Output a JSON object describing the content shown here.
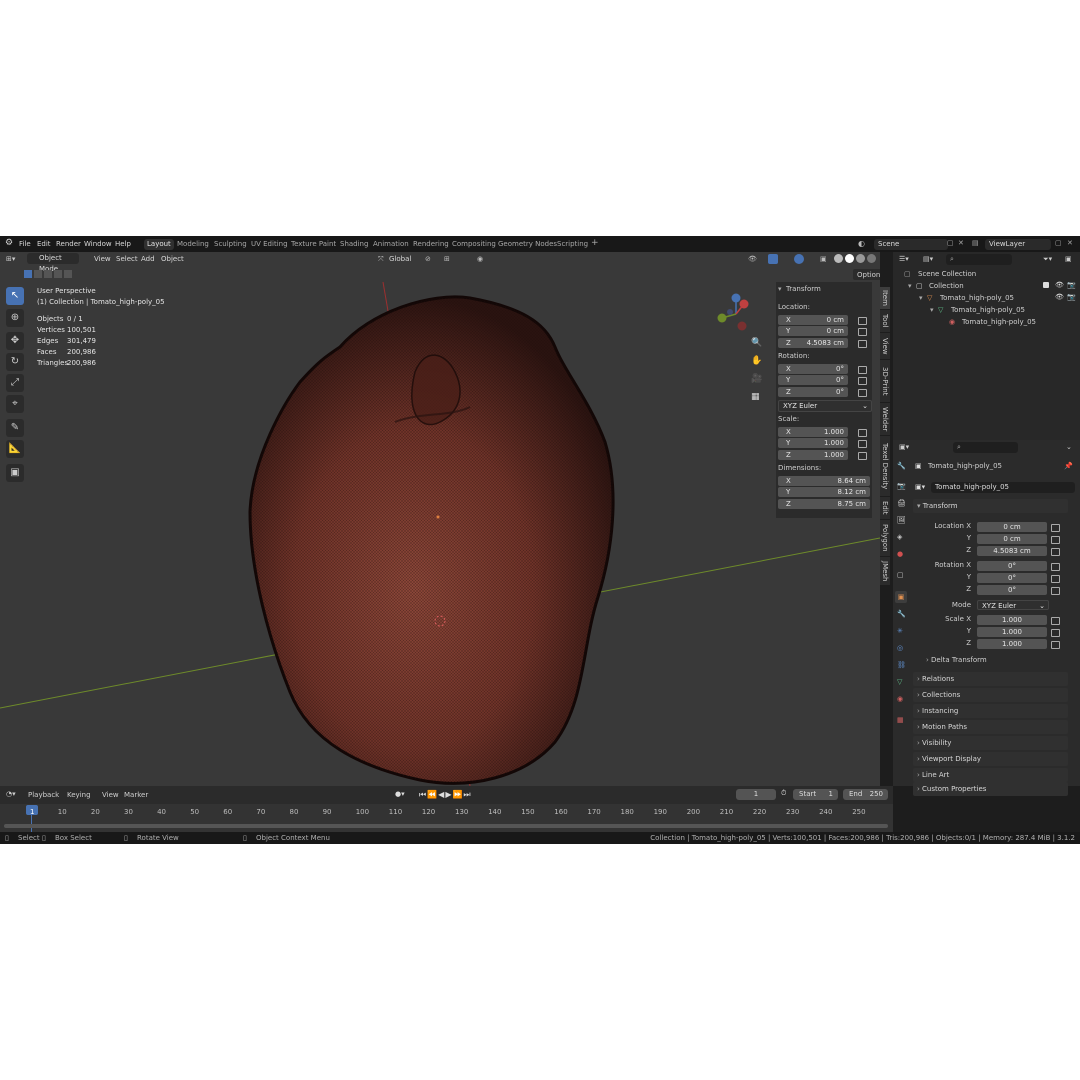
{
  "topbar": {
    "menus": [
      "File",
      "Edit",
      "Render",
      "Window",
      "Help"
    ],
    "workspaces": [
      "Layout",
      "Modeling",
      "Sculpting",
      "UV Editing",
      "Texture Paint",
      "Shading",
      "Animation",
      "Rendering",
      "Compositing",
      "Geometry Nodes",
      "Scripting"
    ],
    "active_workspace": "Layout",
    "add_tab": "+",
    "scene": "Scene",
    "view_layer": "ViewLayer"
  },
  "viewport_header": {
    "mode": "Object Mode",
    "menus": [
      "View",
      "Select",
      "Add",
      "Object"
    ],
    "orientation": "Global",
    "options": "Options"
  },
  "overlay": {
    "perspective": "User Perspective",
    "collection": "(1) Collection | Tomato_high-poly_05",
    "stats": [
      {
        "label": "Objects",
        "value": "0 / 1"
      },
      {
        "label": "Vertices",
        "value": "100,501"
      },
      {
        "label": "Edges",
        "value": "301,479"
      },
      {
        "label": "Faces",
        "value": "200,986"
      },
      {
        "label": "Triangles",
        "value": "200,986"
      }
    ]
  },
  "npanel": {
    "title": "Transform",
    "location_label": "Location:",
    "location": [
      "0 cm",
      "0 cm",
      "4.5083 cm"
    ],
    "rotation_label": "Rotation:",
    "rotation": [
      "0°",
      "0°",
      "0°"
    ],
    "rotation_mode": "XYZ Euler",
    "scale_label": "Scale:",
    "scale": [
      "1.000",
      "1.000",
      "1.000"
    ],
    "dimensions_label": "Dimensions:",
    "dimensions": [
      "8.64 cm",
      "8.12 cm",
      "8.75 cm"
    ],
    "axes": [
      "X",
      "Y",
      "Z"
    ],
    "tabs": [
      "Item",
      "Tool",
      "View",
      "3D-Print",
      "Welder",
      "Texel Density",
      "Edit",
      "Polygon",
      "JMesh"
    ]
  },
  "outliner": {
    "scene_collection": "Scene Collection",
    "collection": "Collection",
    "object": "Tomato_high-poly_05",
    "mesh": "Tomato_high-poly_05",
    "material": "Tomato_high-poly_05"
  },
  "properties": {
    "object_name": "Tomato_high-poly_05",
    "object_field": "Tomato_high-poly_05",
    "transform_title": "Transform",
    "location_x_label": "Location X",
    "rotation_x_label": "Rotation X",
    "scale_x_label": "Scale X",
    "mode_label": "Mode",
    "y_label": "Y",
    "z_label": "Z",
    "location": [
      "0 cm",
      "0 cm",
      "4.5083 cm"
    ],
    "rotation": [
      "0°",
      "0°",
      "0°"
    ],
    "mode": "XYZ Euler",
    "scale": [
      "1.000",
      "1.000",
      "1.000"
    ],
    "sections": [
      "Delta Transform",
      "Relations",
      "Collections",
      "Instancing",
      "Motion Paths",
      "Visibility",
      "Viewport Display",
      "Line Art",
      "Custom Properties"
    ]
  },
  "timeline": {
    "menus": [
      "Playback",
      "Keying",
      "View",
      "Marker"
    ],
    "current_frame": "1",
    "start_label": "Start",
    "start": "1",
    "end_label": "End",
    "end": "250",
    "ticks": [
      "1",
      "10",
      "20",
      "30",
      "40",
      "50",
      "60",
      "70",
      "80",
      "90",
      "100",
      "110",
      "120",
      "130",
      "140",
      "150",
      "160",
      "170",
      "180",
      "190",
      "200",
      "210",
      "220",
      "230",
      "240",
      "250"
    ]
  },
  "statusbar": {
    "select": "Select",
    "box_select": "Box Select",
    "rotate_view": "Rotate View",
    "context_menu": "Object Context Menu",
    "info": "Collection | Tomato_high-poly_05 | Verts:100,501 | Faces:200,986 | Tris:200,986 | Objects:0/1 | Memory: 287.4 MiB | 3.1.2"
  },
  "colors": {
    "accent": "#4772b3",
    "tomato": "#7a3a30",
    "viewport_bg": "#393939",
    "x_axis": "#9c2f2f",
    "y_axis": "#6e8b2a"
  }
}
